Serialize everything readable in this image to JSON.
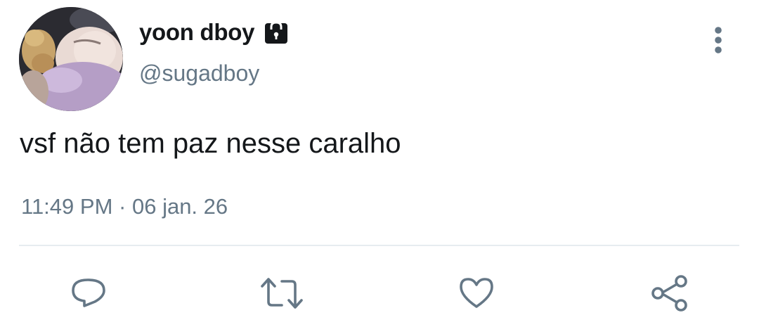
{
  "tweet": {
    "display_name": "yoon dboy",
    "handle": "@sugadboy",
    "text": "vsf não tem paz nesse caralho",
    "time": "11:49 PM",
    "separator": "·",
    "date": "06 jan. 26"
  },
  "icons": {
    "lock": "lock-icon",
    "more": "more-vertical-icon",
    "reply": "reply-icon",
    "retweet": "retweet-icon",
    "like": "heart-icon",
    "share": "share-icon"
  },
  "colors": {
    "text": "#14171a",
    "secondary": "#657786",
    "divider": "#e6ecf0"
  }
}
